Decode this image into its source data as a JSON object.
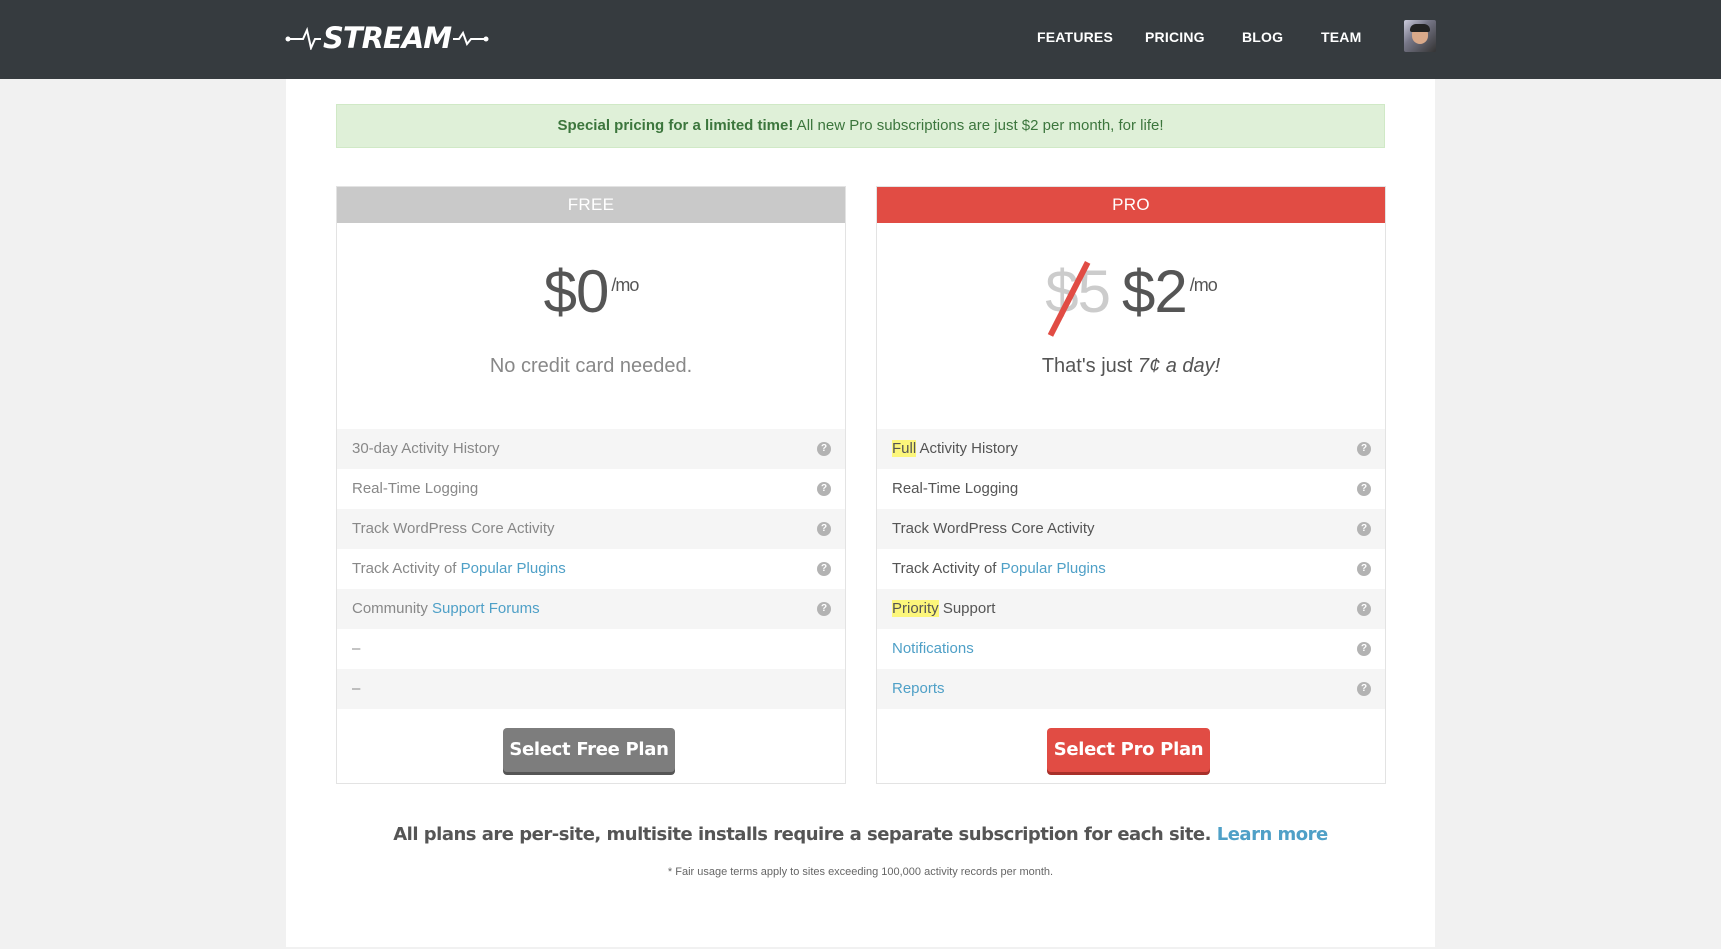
{
  "header": {
    "logo": "STREAM",
    "nav": [
      "FEATURES",
      "PRICING",
      "BLOG",
      "TEAM"
    ]
  },
  "notice": {
    "bold": "Special pricing for a limited time!",
    "text": " All new Pro subscriptions are just $2 per month, for life!"
  },
  "free": {
    "title": "FREE",
    "price": "$0",
    "per": "/mo",
    "tagline": "No credit card needed.",
    "features": {
      "f1": "30-day Activity History",
      "f2": "Real-Time Logging",
      "f3": "Track WordPress Core Activity",
      "f4a": "Track Activity of ",
      "f4b": "Popular Plugins",
      "f5a": "Community ",
      "f5b": "Support Forums",
      "f6": "–",
      "f7": "–"
    },
    "button": "Select Free Plan"
  },
  "pro": {
    "title": "PRO",
    "old_price": "$5",
    "price": "$2",
    "per": "/mo",
    "tagline_a": "That's just ",
    "tagline_b": "7¢ a day!",
    "features": {
      "f1a": "Full",
      "f1b": " Activity History",
      "f2": "Real-Time Logging",
      "f3": "Track WordPress Core Activity",
      "f4a": "Track Activity of ",
      "f4b": "Popular Plugins",
      "f5a": "Priority",
      "f5b": " Support",
      "f6": "Notifications",
      "f7": "Reports"
    },
    "button": "Select Pro Plan"
  },
  "footer": {
    "text": "All plans are per-site, multisite installs require a separate subscription for each site. ",
    "learn": "Learn more",
    "small": "* Fair usage terms apply to sites exceeding 100,000 activity records per month."
  },
  "help_glyph": "?"
}
